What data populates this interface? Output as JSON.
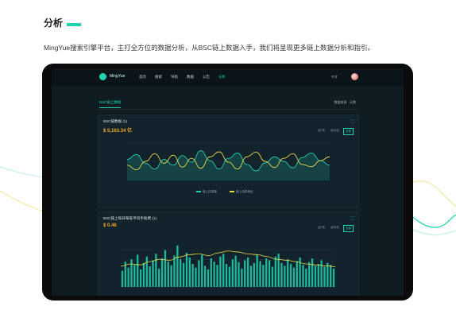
{
  "intro": {
    "title": "分析",
    "description": "MingYue搜索引擎平台，主打全方位的数据分析，从BSC链上数据入手，我们将呈现更多链上数据分析和指引。"
  },
  "colors": {
    "accent": "#1fd3b0",
    "gold": "#f5a623",
    "dark": "#0f1c22"
  },
  "app": {
    "brand": "MingYue",
    "nav": [
      "首页",
      "搜索",
      "导航",
      "数据",
      "公告",
      "分析"
    ],
    "active_nav_index": 5,
    "lang": "中文",
    "avatar_icon": "user-avatar-icon"
  },
  "subtabs": {
    "active": "BSC链上数据",
    "right": "数据来源 · 天数"
  },
  "card1": {
    "title": "BSC链数据 (1)",
    "value": "$ 5,163.34 亿",
    "ranges": [
      "近7天",
      "近30天",
      "全部"
    ],
    "active_range": 2,
    "legend": [
      "链上交易量",
      "链上活跃地址"
    ]
  },
  "card2": {
    "title": "BSC链上每日每笔平均手续费 (1)",
    "value": "$ 0.46",
    "ranges": [
      "近7天",
      "近30天",
      "全部"
    ],
    "active_range": 2
  },
  "chart_data": [
    {
      "type": "line",
      "series": [
        {
          "name": "链上交易量",
          "values": [
            0.55,
            0.68,
            0.45,
            0.3,
            0.55,
            0.4,
            0.65,
            0.48,
            0.78,
            0.52,
            0.3,
            0.58,
            0.72,
            0.42,
            0.25,
            0.46,
            0.62,
            0.5,
            0.33,
            0.6,
            0.72,
            0.52,
            0.4
          ]
        },
        {
          "name": "链上活跃地址",
          "values": [
            0.4,
            0.28,
            0.5,
            0.7,
            0.45,
            0.66,
            0.35,
            0.58,
            0.32,
            0.62,
            0.75,
            0.48,
            0.3,
            0.62,
            0.74,
            0.5,
            0.34,
            0.58,
            0.7,
            0.42,
            0.36,
            0.52,
            0.62
          ]
        }
      ]
    },
    {
      "type": "bar",
      "series": [
        {
          "name": "bars",
          "values": [
            0.35,
            0.55,
            0.42,
            0.6,
            0.48,
            0.7,
            0.38,
            0.52,
            0.66,
            0.45,
            0.58,
            0.72,
            0.4,
            0.62,
            0.8,
            0.55,
            0.47,
            0.68,
            0.9,
            0.6,
            0.52,
            0.74,
            0.64,
            0.5,
            0.42,
            0.58,
            0.7,
            0.46,
            0.38,
            0.62,
            0.55,
            0.48,
            0.66,
            0.72,
            0.5,
            0.44,
            0.6,
            0.68,
            0.54,
            0.4,
            0.58,
            0.64,
            0.46,
            0.52,
            0.7,
            0.56,
            0.48,
            0.62,
            0.58,
            0.44,
            0.66,
            0.72,
            0.52,
            0.46,
            0.6,
            0.5,
            0.42,
            0.56,
            0.64,
            0.48,
            0.4,
            0.54,
            0.62,
            0.46,
            0.5,
            0.58,
            0.44,
            0.52,
            0.48,
            0.4
          ]
        },
        {
          "name": "line",
          "values": [
            0.45,
            0.5,
            0.48,
            0.55,
            0.6,
            0.58,
            0.65,
            0.7,
            0.72,
            0.68,
            0.74,
            0.78,
            0.76,
            0.72,
            0.7,
            0.66,
            0.6,
            0.58,
            0.55,
            0.5,
            0.48,
            0.46,
            0.44
          ]
        }
      ]
    }
  ]
}
